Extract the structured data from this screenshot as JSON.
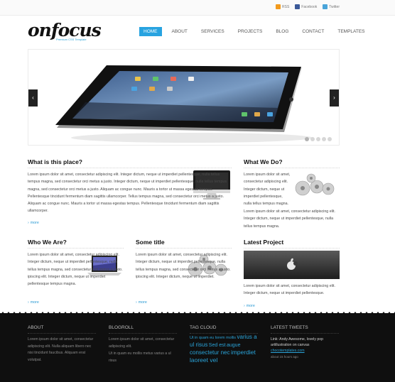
{
  "social": [
    {
      "label": "RSS",
      "icon": "rss-icon"
    },
    {
      "label": "Facebook",
      "icon": "facebook-icon"
    },
    {
      "label": "Twitter",
      "icon": "twitter-icon"
    }
  ],
  "logo": {
    "name": "onfocus",
    "tagline": "Premium CSS Template"
  },
  "nav": [
    "HOME",
    "ABOUT",
    "SERVICES",
    "PROJECTS",
    "BLOG",
    "CONTACT",
    "TEMPLATES"
  ],
  "slider": {
    "prev": "‹",
    "next": "›",
    "dots_count": 5,
    "active_dot": 1
  },
  "sections": {
    "what_is": {
      "title": "What is this place?",
      "text": "Lorem ipsum dolor sit amet, consectetur adipiscing elit. Integer dictum, neque ut imperdiet pellentesque, nulla tellus tempus magna, sed consectetur orci metus a justo. Integer dictum, neque ut imperdiet pellentesque, nulla tellus tempus magna, sed consectetur orci metus a justo. Aliquam ac congue nunc. Mauris a tortor ut massa egestas tempus. Pellentesque tincidunt fermentum diam sagittis ullamcorper. Tellus tempus magna, sed consectetur orci metus a justo. Aliquam ac congue nunc. Mauris a tortor ut massa egestas tempus. Pellentesque tincidunt fermentum diam sagittis ullamcorper.",
      "more": "more"
    },
    "what_we_do": {
      "title": "What We Do?",
      "text_a": "Lorem ipsum dolor sit amet, consectetur adipiscing elit. Integer dictum, neque ut imperdiet pellentesque, nulla tellus tempus magna.",
      "text_b": "Lorem ipsum dolor sit amet, consectetur adipiscing elit. Integer dictum, neque ut imperdiet pellentesque, nulla tellus tempus magna."
    },
    "who_we_are": {
      "title": "Who We Are?",
      "text": "Lorem ipsum dolor sit amet, consectetur adipiscing elit. Integer dictum, neque ut imperdiet pellentesque, nulla tellus tempus magna, sed consectetur orci metus a justo. ipiscing elit. Integer dictum, neque ut imperdiet pellentesque tempus magna.",
      "more": "more"
    },
    "some_title": {
      "title": "Some title",
      "text": "Lorem ipsum dolor sit amet, consectetur adipiscing elit. Integer dictum, neque ut imperdiet pellentesque, nulla tellus tempus magna, sed consectetur orci metus a justo. ipiscing elit. Integer dictum, neque ut imperdiet.",
      "more": "more"
    },
    "latest_project": {
      "title": "Latest Project",
      "text": "Lorem ipsum dolor sit amet, consectetur adipiscing elit. Integer dictum, neque ut imperdiet pellentesque.",
      "more": "more"
    }
  },
  "footer": {
    "about": {
      "title": "ABOUT",
      "text": "Lorem ipsum dolor sit amet, consectetur adipiscing elit. Nulla aliquam libero nec nisi tincidunt faucibus. Aliquam erat volutpat."
    },
    "blogroll": {
      "title": "BLOGROLL",
      "items": [
        "Lorem ipsum dolor sit amet, consectetur adipiscing elit.",
        "Ut in quam eu mollis metus varius a ul risus"
      ]
    },
    "tag_cloud": {
      "title": "TAG CLOUD",
      "tags": [
        "Ut in quam",
        "eu lorem mollis",
        "varius a ul risus",
        "Sed est",
        "augue",
        "consectetur nec",
        "imperdiet laoreet vel"
      ]
    },
    "latest_tweets": {
      "title": "LATEST TWEETS",
      "text": "Link: Andy Awesome, lovely pop artillustration on canvas",
      "link": "chocotemplates.com",
      "time": "about 15 hours ago"
    }
  },
  "colors": {
    "accent": "#28a3e0",
    "footer_bg": "#0f0f0f"
  }
}
